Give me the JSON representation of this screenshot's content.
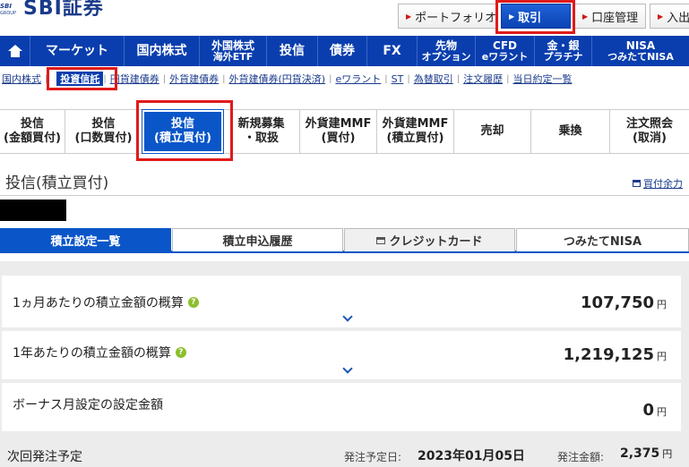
{
  "header": {
    "logo_small": "SBI",
    "logo_group": "GROUP",
    "logo_text": "SBI証券",
    "buttons": {
      "portfolio": "ポートフォリオ",
      "trade": "取引",
      "account": "口座管理",
      "deposit": "入出"
    }
  },
  "mainnav": {
    "market": "マーケット",
    "domestic_stock": "国内株式",
    "foreign_stock_1": "外国株式",
    "foreign_stock_2": "海外ETF",
    "trust": "投信",
    "bonds": "債券",
    "fx": "FX",
    "futures_1": "先物",
    "futures_2": "オプション",
    "cfd_1": "CFD",
    "cfd_2": "eワラント",
    "gold_1": "金・銀",
    "gold_2": "プラチナ",
    "nisa_1": "NISA",
    "nisa_2": "つみたてNISA"
  },
  "subnav": {
    "items": [
      "国内株式",
      "投資信託",
      "円貨建債券",
      "外貨建債券",
      "外貨建債券(円貨決済)",
      "eワラント",
      "ST",
      "為替取引",
      "注文履歴",
      "当日約定一覧"
    ]
  },
  "tabs": {
    "t1_1": "投信",
    "t1_2": "(金額買付)",
    "t2_1": "投信",
    "t2_2": "(口数買付)",
    "t3_1": "投信",
    "t3_2": "(積立買付)",
    "t4_1": "新規募集",
    "t4_2": "・取扱",
    "t5_1": "外貨建MMF",
    "t5_2": "(買付)",
    "t6_1": "外貨建MMF",
    "t6_2": "(積立買付)",
    "t7": "売却",
    "t8": "乗換",
    "t9_1": "注文照会",
    "t9_2": "(取消)"
  },
  "page": {
    "title": "投信(積立買付)",
    "link": "買付余力"
  },
  "subtabs": {
    "s1": "積立設定一覧",
    "s2": "積立申込履歴",
    "s3": "クレジットカード",
    "s4": "つみたてNISA"
  },
  "summary": {
    "monthly_label": "1ヵ月あたりの積立金額の概算",
    "monthly_value": "107,750",
    "yearly_label": "1年あたりの積立金額の概算",
    "yearly_value": "1,219,125",
    "bonus_label": "ボーナス月設定の設定金額",
    "bonus_value": "0",
    "unit": "円",
    "help": "?",
    "next_label": "次回発注予定",
    "next_date_label": "発注予定日:",
    "next_date": "2023年01月05日",
    "next_amount_label": "発注金額:",
    "next_amount": "2,375"
  },
  "icons": {
    "home": "home-icon",
    "triangle": "triangle-right-icon",
    "chevron": "chevron-down-icon",
    "window": "window-icon",
    "card": "card-icon"
  },
  "colors": {
    "nav_blue": "#0a3eae",
    "active_blue": "#0a56c8",
    "highlight_red": "#e01a1a",
    "help_green": "#8cbf2c"
  }
}
